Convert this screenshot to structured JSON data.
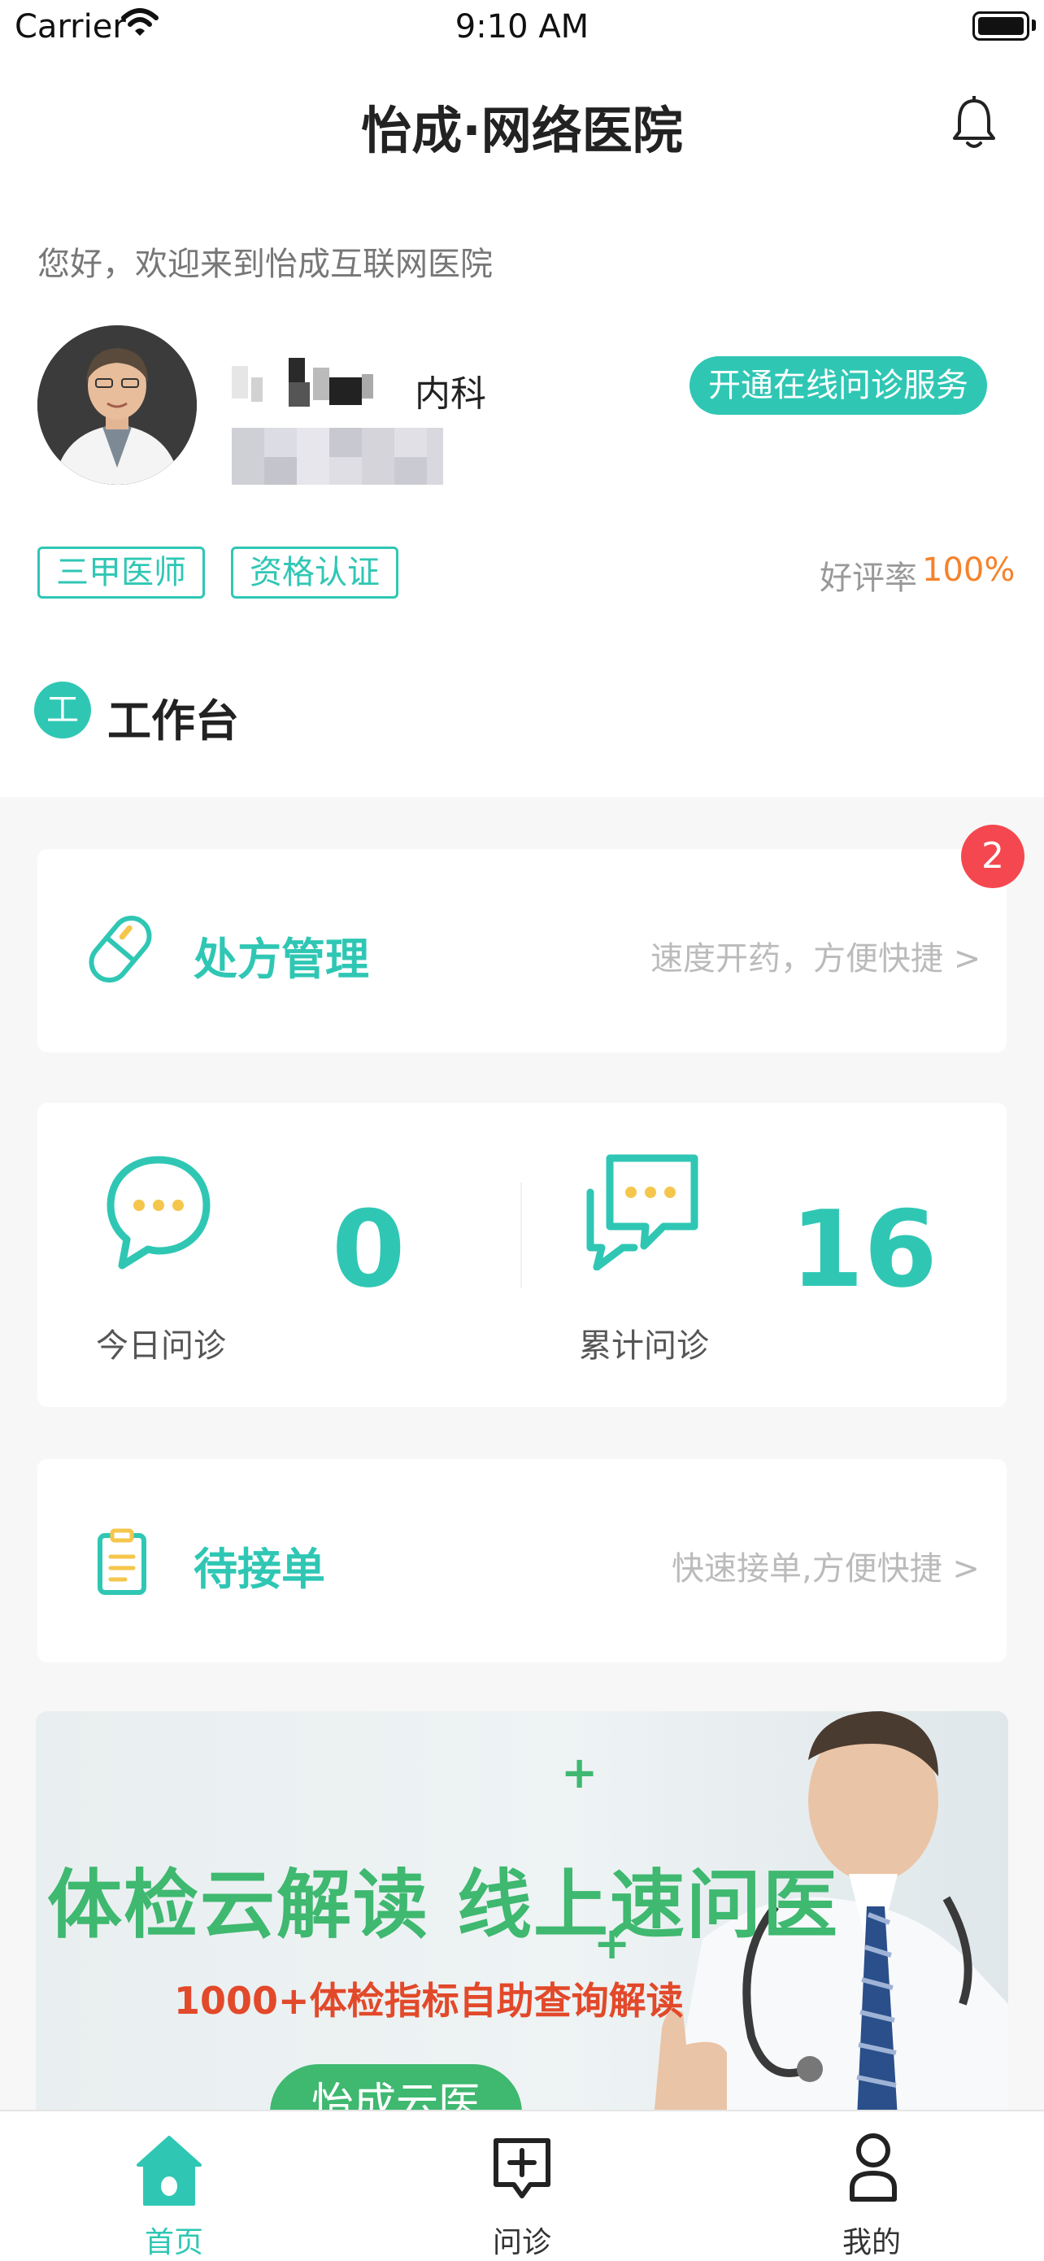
{
  "status_bar": {
    "carrier": "Carrier",
    "time": "9:10 AM"
  },
  "header": {
    "title": "怡成·网络医院"
  },
  "doctor": {
    "welcome": "您好，欢迎来到怡成互联网医院",
    "department": "内科",
    "open_service_label": "开通在线问诊服务",
    "tags": [
      "三甲医师",
      "资格认证"
    ],
    "rating_label": "好评率",
    "rating_value": "100%"
  },
  "workspace": {
    "badge_char": "工",
    "title": "工作台",
    "prescription": {
      "title": "处方管理",
      "subtitle": "速度开药，方便快捷 >",
      "badge": "2"
    },
    "stats": {
      "today": {
        "label": "今日问诊",
        "value": "0"
      },
      "total": {
        "label": "累计问诊",
        "value": "16"
      }
    },
    "pending": {
      "title": "待接单",
      "subtitle": "快速接单,方便快捷 >"
    }
  },
  "banner": {
    "title": "体检云解读 线上速问医",
    "subtitle": "1000+体检指标自助查询解读",
    "button": "怡成云医"
  },
  "tabbar": {
    "items": [
      {
        "label": "首页",
        "icon": "home-icon"
      },
      {
        "label": "问诊",
        "icon": "consult-icon"
      },
      {
        "label": "我的",
        "icon": "profile-icon"
      }
    ]
  },
  "colors": {
    "accent": "#2fc7b4",
    "rating": "#f5822b",
    "badge": "#f5474f",
    "banner_green": "#3fb870",
    "banner_red": "#e2492a"
  }
}
